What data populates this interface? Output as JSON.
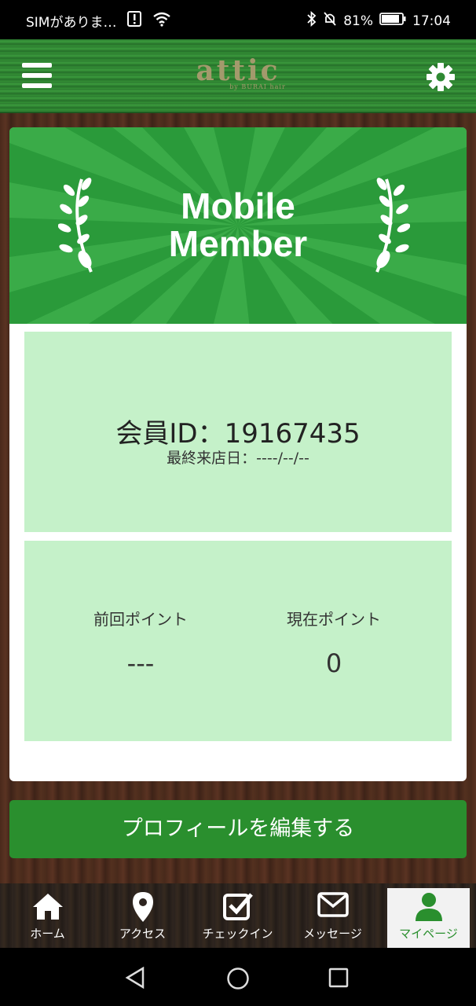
{
  "status_bar": {
    "carrier": "SIMがありま…",
    "battery": "81%",
    "time": "17:04"
  },
  "header": {
    "logo": "attic",
    "logo_sub": "by BURAI hair",
    "menu_icon": "hamburger-menu-icon",
    "settings_icon": "gear-icon"
  },
  "banner": {
    "title_line1": "Mobile",
    "title_line2": "Member"
  },
  "member": {
    "id_text": "会員ID：19167435",
    "last_visit": "最終来店日：----/--/--"
  },
  "points": {
    "previous_label": "前回ポイント",
    "previous_value": "---",
    "current_label": "現在ポイント",
    "current_value": "0"
  },
  "edit_profile_button": "プロフィールを編集する",
  "tabs": [
    {
      "label": "ホーム",
      "icon": "home-icon",
      "active": false
    },
    {
      "label": "アクセス",
      "icon": "map-pin-icon",
      "active": false
    },
    {
      "label": "チェックイン",
      "icon": "checkbox-icon",
      "active": false
    },
    {
      "label": "メッセージ",
      "icon": "envelope-icon",
      "active": false
    },
    {
      "label": "マイページ",
      "icon": "user-icon",
      "active": true
    }
  ],
  "colors": {
    "accent_green": "#2a8f2e",
    "panel_green": "#c5f1c9",
    "banner_green": "#2a9a3a"
  }
}
